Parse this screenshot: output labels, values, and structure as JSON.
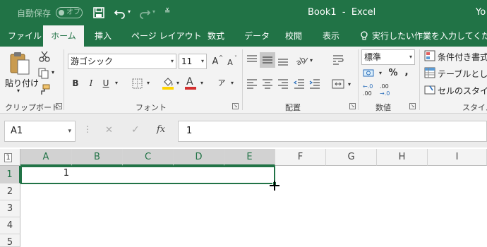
{
  "title_bar": {
    "autosave_label": "自動保存",
    "autosave_state": "オフ",
    "document_title": "Book1  -  Excel",
    "user": "Yo"
  },
  "tabs": [
    "ファイル",
    "ホーム",
    "挿入",
    "ページ レイアウト",
    "数式",
    "データ",
    "校閲",
    "表示"
  ],
  "tell_me": "実行したい作業を入力してください",
  "ribbon": {
    "clipboard": {
      "paste_label": "貼り付け",
      "group_label": "クリップボード"
    },
    "font": {
      "font_name": "游ゴシック",
      "font_size": "11",
      "bold": "B",
      "italic": "I",
      "underline": "U",
      "grow": "A",
      "shrink": "A",
      "group_label": "フォント",
      "font_color_accent": "#d32f2f",
      "fill_color_accent": "#ffd400"
    },
    "alignment": {
      "group_label": "配置"
    },
    "number": {
      "format": "標準",
      "percent": "%",
      "comma": ",",
      "inc_decimal_top": "←.0",
      "inc_decimal_bottom": ".00",
      "dec_decimal_top": ".00",
      "dec_decimal_bottom": "→.0",
      "group_label": "数値"
    },
    "styles": {
      "conditional": "条件付き書式",
      "as_table": "テーブルとして書",
      "cell_styles": "セルのスタイル",
      "group_label": "スタイル"
    }
  },
  "formula_bar": {
    "name_box": "A1",
    "cancel": "✕",
    "enter": "✓",
    "fx": "fx",
    "content": "1"
  },
  "sheet": {
    "corner": "1",
    "columns": [
      "A",
      "B",
      "C",
      "D",
      "E",
      "F",
      "G",
      "H",
      "I"
    ],
    "rows": [
      "1",
      "2",
      "3",
      "4",
      "5"
    ],
    "cell_A1": "1"
  },
  "colors": {
    "brand": "#217346"
  }
}
